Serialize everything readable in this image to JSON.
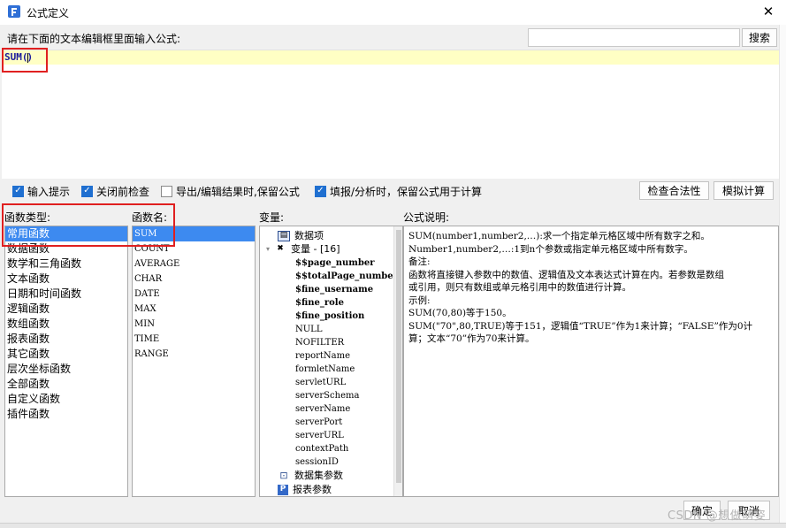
{
  "window": {
    "title": "公式定义",
    "close_glyph": "✕",
    "app_icon": "fr-logo-icon",
    "accent": "#3d8af0"
  },
  "instruction": "请在下面的文本编辑框里面输入公式:",
  "search": {
    "value": "",
    "placeholder": "",
    "button_label": "搜索"
  },
  "editor": {
    "formula_prefix": "SUM(",
    "formula_suffix": ")"
  },
  "options": [
    {
      "label": "输入提示",
      "checked": true
    },
    {
      "label": "关闭前检查",
      "checked": true
    },
    {
      "label": "导出/编辑结果时,保留公式",
      "checked": false
    },
    {
      "label": "填报/分析时，保留公式用于计算",
      "checked": true
    }
  ],
  "buttons": {
    "validate": "检查合法性",
    "simulate": "模拟计算",
    "ok": "确定",
    "cancel": "取消"
  },
  "function_types": {
    "label": "函数类型:",
    "selected_index": 0,
    "items": [
      "常用函数",
      "数据函数",
      "数学和三角函数",
      "文本函数",
      "日期和时间函数",
      "逻辑函数",
      "数组函数",
      "报表函数",
      "其它函数",
      "层次坐标函数",
      "全部函数",
      "自定义函数",
      "插件函数"
    ]
  },
  "function_names": {
    "label": "函数名:",
    "selected_index": 0,
    "items": [
      "SUM",
      "COUNT",
      "AVERAGE",
      "CHAR",
      "DATE",
      "MAX",
      "MIN",
      "TIME",
      "RANGE"
    ]
  },
  "variables": {
    "label": "变量:",
    "data_items_label": "数据项",
    "variables_group": {
      "label": "变量 - [16]",
      "expander": "▾"
    },
    "items": [
      "$$page_number",
      "$$totalPage_number",
      "$fine_username",
      "$fine_role",
      "$fine_position",
      "NULL",
      "NOFILTER",
      "reportName",
      "formletName",
      "servletURL",
      "serverSchema",
      "serverName",
      "serverPort",
      "serverURL",
      "contextPath",
      "sessionID"
    ],
    "dataset_params_label": "数据集参数",
    "report_params_label": "报表参数"
  },
  "description": {
    "label": "公式说明:",
    "lines": [
      "SUM(number1,number2,…):求一个指定单元格区域中所有数字之和。",
      "Number1,number2,…:1到n个参数或指定单元格区域中所有数字。",
      "备注:",
      "函数将直接键入参数中的数值、逻辑值及文本表达式计算在内。若参数是数组",
      "或引用，则只有数组或单元格引用中的数值进行计算。",
      "示例:",
      "SUM(70,80)等于150。",
      "SUM(\"70\",80,TRUE)等于151，逻辑值“TRUE”作为1来计算；“FALSE”作为0计",
      "算；文本“70”作为70来计算。"
    ]
  },
  "watermark": "CSDN @想做萌姿"
}
